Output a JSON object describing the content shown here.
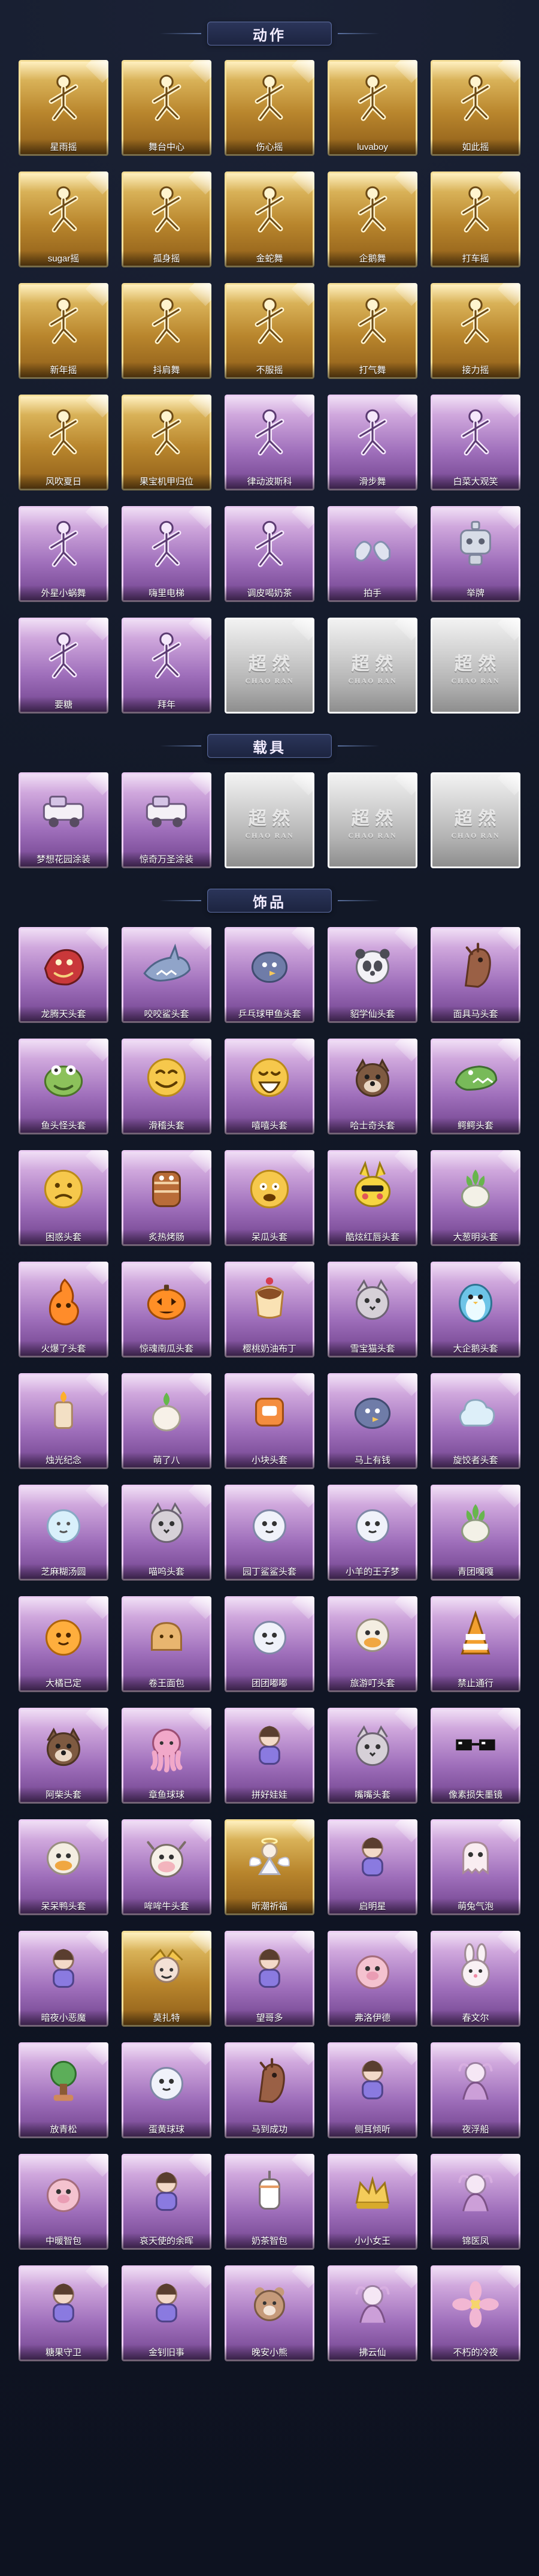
{
  "sections": {
    "actions": {
      "title": "动作",
      "items": [
        {
          "label": "星雨摇",
          "frame": "gold",
          "icon": "pose-icon"
        },
        {
          "label": "舞台中心",
          "frame": "gold",
          "icon": "pose-icon"
        },
        {
          "label": "伤心摇",
          "frame": "gold",
          "icon": "pose-icon"
        },
        {
          "label": "luvaboy",
          "frame": "gold",
          "icon": "pose-icon"
        },
        {
          "label": "如此摇",
          "frame": "gold",
          "icon": "pose-icon"
        },
        {
          "label": "sugar摇",
          "frame": "gold",
          "icon": "pose-icon"
        },
        {
          "label": "孤身摇",
          "frame": "gold",
          "icon": "pose-icon"
        },
        {
          "label": "金蛇舞",
          "frame": "gold",
          "icon": "pose-icon"
        },
        {
          "label": "企鹅舞",
          "frame": "gold",
          "icon": "pose-icon"
        },
        {
          "label": "打车摇",
          "frame": "gold",
          "icon": "pose-icon"
        },
        {
          "label": "新年摇",
          "frame": "gold",
          "icon": "pose-icon"
        },
        {
          "label": "抖肩舞",
          "frame": "gold",
          "icon": "pose-icon"
        },
        {
          "label": "不服摇",
          "frame": "gold",
          "icon": "pose-icon"
        },
        {
          "label": "打气舞",
          "frame": "gold",
          "icon": "pose-icon"
        },
        {
          "label": "接力摇",
          "frame": "gold",
          "icon": "pose-icon"
        },
        {
          "label": "风吹夏日",
          "frame": "gold",
          "icon": "pose-icon"
        },
        {
          "label": "果宝机甲归位",
          "frame": "gold",
          "icon": "pose-icon"
        },
        {
          "label": "律动波斯科",
          "frame": "purple",
          "icon": "pose-icon"
        },
        {
          "label": "滑步舞",
          "frame": "purple",
          "icon": "pose-icon"
        },
        {
          "label": "白菜大观笑",
          "frame": "purple",
          "icon": "pose-icon"
        },
        {
          "label": "外星小蜗舞",
          "frame": "purple",
          "icon": "pose-icon"
        },
        {
          "label": "嗨里电梯",
          "frame": "purple",
          "icon": "pose-icon"
        },
        {
          "label": "调皮喝奶茶",
          "frame": "purple",
          "icon": "pose-icon"
        },
        {
          "label": "拍手",
          "frame": "purple",
          "icon": "hands-icon"
        },
        {
          "label": "举牌",
          "frame": "purple",
          "icon": "robot-icon"
        },
        {
          "label": "要糖",
          "frame": "purple",
          "icon": "pose-icon"
        },
        {
          "label": "拜年",
          "frame": "purple",
          "icon": "pose-icon"
        },
        {
          "label": "",
          "frame": "gray",
          "icon": "logo-placeholder"
        },
        {
          "label": "",
          "frame": "gray",
          "icon": "logo-placeholder"
        },
        {
          "label": "",
          "frame": "gray",
          "icon": "logo-placeholder"
        }
      ]
    },
    "vehicles": {
      "title": "载具",
      "items": [
        {
          "label": "梦想花园涂装",
          "frame": "purple",
          "icon": "vehicle-icon"
        },
        {
          "label": "惊奇万圣涂装",
          "frame": "purple",
          "icon": "vehicle-icon"
        },
        {
          "label": "",
          "frame": "gray",
          "icon": "logo-placeholder"
        },
        {
          "label": "",
          "frame": "gray",
          "icon": "logo-placeholder"
        },
        {
          "label": "",
          "frame": "gray",
          "icon": "logo-placeholder"
        }
      ]
    },
    "accessories": {
      "title": "饰品",
      "items": [
        {
          "label": "龙腾天头套",
          "frame": "purple",
          "icon": "dragon-head-icon"
        },
        {
          "label": "咬咬鲨头套",
          "frame": "purple",
          "icon": "shark-icon"
        },
        {
          "label": "乒乓球甲鱼头套",
          "frame": "purple",
          "icon": "bird-icon"
        },
        {
          "label": "貂学仙头套",
          "frame": "purple",
          "icon": "panda-icon"
        },
        {
          "label": "面具马头套",
          "frame": "purple",
          "icon": "horse-icon"
        },
        {
          "label": "鱼头怪头套",
          "frame": "purple",
          "icon": "frog-icon"
        },
        {
          "label": "滑稽头套",
          "frame": "purple",
          "icon": "emoji-grin-icon"
        },
        {
          "label": "嘻嘻头套",
          "frame": "purple",
          "icon": "emoji-laugh-icon"
        },
        {
          "label": "哈士奇头套",
          "frame": "purple",
          "icon": "dog-icon"
        },
        {
          "label": "鳄鳄头套",
          "frame": "purple",
          "icon": "crocodile-icon"
        },
        {
          "label": "困惑头套",
          "frame": "purple",
          "icon": "emoji-worried-icon"
        },
        {
          "label": "炙热烤肠",
          "frame": "purple",
          "icon": "snack-icon"
        },
        {
          "label": "呆瓜头套",
          "frame": "purple",
          "icon": "emoji-dumb-icon"
        },
        {
          "label": "酷炫红唇头套",
          "frame": "purple",
          "icon": "pikachu-icon"
        },
        {
          "label": "大葱明头套",
          "frame": "purple",
          "icon": "vegetable-icon"
        },
        {
          "label": "火爆了头套",
          "frame": "purple",
          "icon": "flame-icon"
        },
        {
          "label": "惊魂南瓜头套",
          "frame": "purple",
          "icon": "pumpkin-icon"
        },
        {
          "label": "樱桃奶油布丁",
          "frame": "purple",
          "icon": "pudding-icon"
        },
        {
          "label": "雪宝猫头套",
          "frame": "purple",
          "icon": "cat-icon"
        },
        {
          "label": "大企鹅头套",
          "frame": "purple",
          "icon": "penguin-icon"
        },
        {
          "label": "烛光纪念",
          "frame": "purple",
          "icon": "candle-icon"
        },
        {
          "label": "萌了八",
          "frame": "purple",
          "icon": "radish-icon"
        },
        {
          "label": "小块头套",
          "frame": "purple",
          "icon": "box-icon"
        },
        {
          "label": "马上有钱",
          "frame": "purple",
          "icon": "bird-icon"
        },
        {
          "label": "旋饺者头套",
          "frame": "purple",
          "icon": "cloud-icon"
        },
        {
          "label": "芝麻糊汤圆",
          "frame": "purple",
          "icon": "bubble-icon"
        },
        {
          "label": "喵呜头套",
          "frame": "purple",
          "icon": "cat-icon"
        },
        {
          "label": "园丁鲨鲨头套",
          "frame": "purple",
          "icon": "mascot-icon"
        },
        {
          "label": "小羊的王子梦",
          "frame": "purple",
          "icon": "mascot-icon"
        },
        {
          "label": "青团嘎嘎",
          "frame": "purple",
          "icon": "vegetable-icon"
        },
        {
          "label": "大橘已定",
          "frame": "purple",
          "icon": "orange-icon"
        },
        {
          "label": "卷王面包",
          "frame": "purple",
          "icon": "bread-icon"
        },
        {
          "label": "团团嘟嘟",
          "frame": "purple",
          "icon": "mascot-icon"
        },
        {
          "label": "旅游叮头套",
          "frame": "purple",
          "icon": "duck-icon"
        },
        {
          "label": "禁止通行",
          "frame": "purple",
          "icon": "cone-icon"
        },
        {
          "label": "阿柴头套",
          "frame": "purple",
          "icon": "dog-icon"
        },
        {
          "label": "章鱼球球",
          "frame": "purple",
          "icon": "octopus-icon"
        },
        {
          "label": "拼好娃娃",
          "frame": "purple",
          "icon": "doll-icon"
        },
        {
          "label": "嘴嘴头套",
          "frame": "purple",
          "icon": "cat-icon"
        },
        {
          "label": "像素损失墨镜",
          "frame": "purple",
          "icon": "glasses-icon"
        },
        {
          "label": "呆呆鸭头套",
          "frame": "purple",
          "icon": "duck-icon"
        },
        {
          "label": "哞哞牛头套",
          "frame": "purple",
          "icon": "cow-icon"
        },
        {
          "label": "昕潮祈福",
          "frame": "gold",
          "icon": "angel-icon"
        },
        {
          "label": "启明星",
          "frame": "purple",
          "icon": "doll-icon"
        },
        {
          "label": "萌兔气泡",
          "frame": "purple",
          "icon": "ghost-icon"
        },
        {
          "label": "暗夜小恶魔",
          "frame": "purple",
          "icon": "doll-icon"
        },
        {
          "label": "莫扎特",
          "frame": "gold",
          "icon": "jester-icon"
        },
        {
          "label": "望哥多",
          "frame": "purple",
          "icon": "doll-icon"
        },
        {
          "label": "弗洛伊德",
          "frame": "purple",
          "icon": "pig-icon"
        },
        {
          "label": "春文尔",
          "frame": "purple",
          "icon": "bunny-icon"
        },
        {
          "label": "放青松",
          "frame": "purple",
          "icon": "tree-icon"
        },
        {
          "label": "蛋黄球球",
          "frame": "purple",
          "icon": "mascot-icon"
        },
        {
          "label": "马到成功",
          "frame": "purple",
          "icon": "horse-icon"
        },
        {
          "label": "侧耳倾听",
          "frame": "purple",
          "icon": "doll-icon"
        },
        {
          "label": "夜浮船",
          "frame": "purple",
          "icon": "spirit-icon"
        },
        {
          "label": "中暖智包",
          "frame": "purple",
          "icon": "pig-icon"
        },
        {
          "label": "哀天使的余晖",
          "frame": "purple",
          "icon": "doll-icon"
        },
        {
          "label": "奶茶智包",
          "frame": "purple",
          "icon": "cup-icon"
        },
        {
          "label": "小小女王",
          "frame": "purple",
          "icon": "crown-icon"
        },
        {
          "label": "锦医凤",
          "frame": "purple",
          "icon": "spirit-icon"
        },
        {
          "label": "糖果守卫",
          "frame": "purple",
          "icon": "doll-icon"
        },
        {
          "label": "金钊旧事",
          "frame": "purple",
          "icon": "doll-icon"
        },
        {
          "label": "晚安小熊",
          "frame": "purple",
          "icon": "bear-icon"
        },
        {
          "label": "拂云仙",
          "frame": "purple",
          "icon": "spirit-icon"
        },
        {
          "label": "不朽的冷夜",
          "frame": "purple",
          "icon": "flower-icon"
        }
      ]
    }
  }
}
